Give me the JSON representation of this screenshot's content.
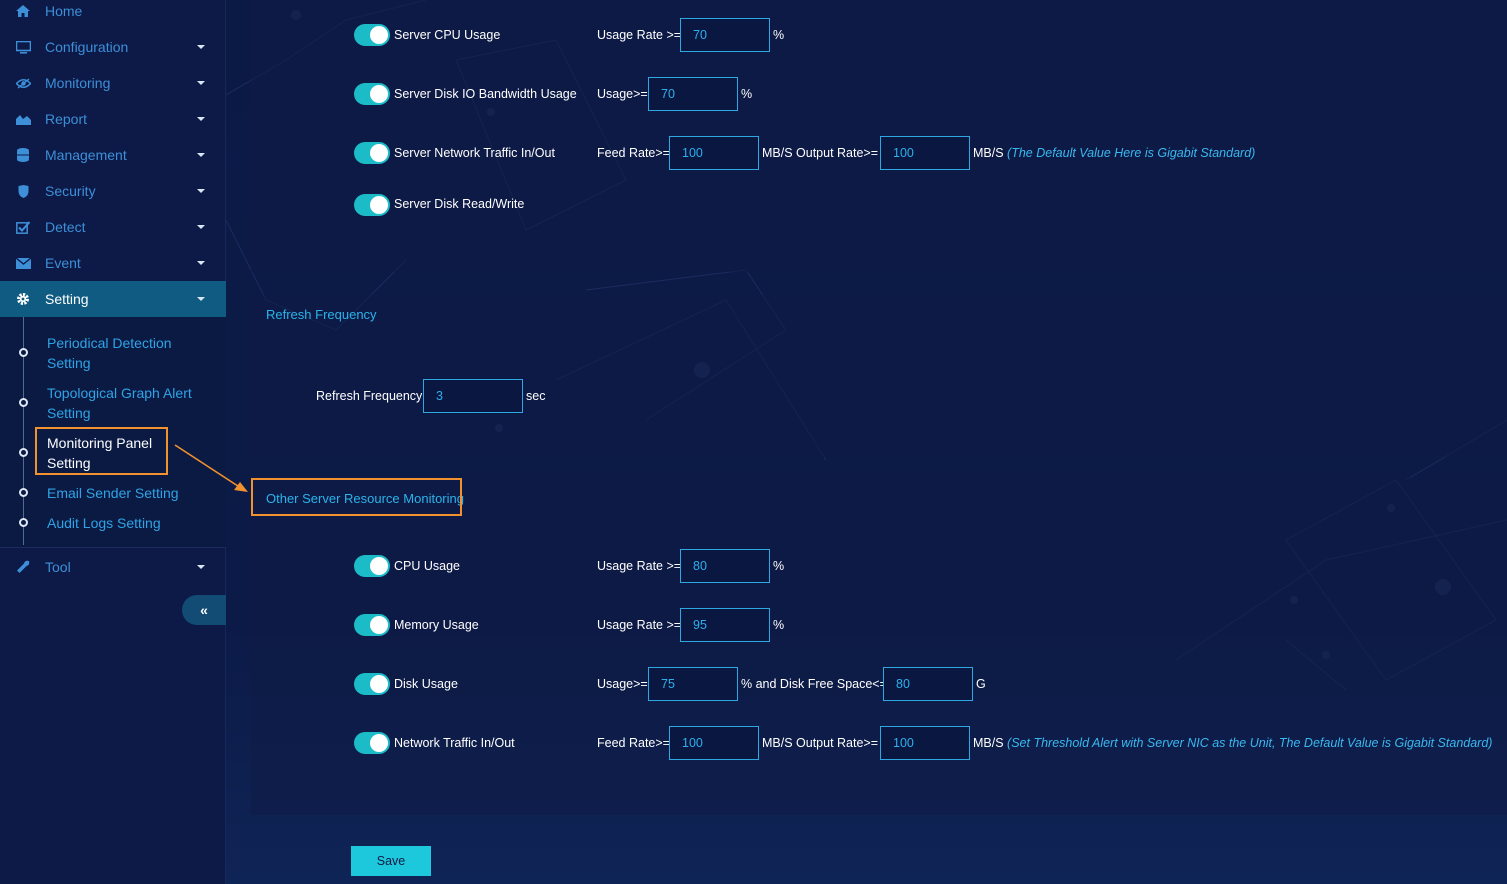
{
  "sidebar": {
    "items": [
      {
        "label": "Home",
        "icon": "home-icon"
      },
      {
        "label": "Configuration",
        "icon": "monitor-icon"
      },
      {
        "label": "Monitoring",
        "icon": "eye-icon"
      },
      {
        "label": "Report",
        "icon": "area-chart-icon"
      },
      {
        "label": "Management",
        "icon": "database-icon"
      },
      {
        "label": "Security",
        "icon": "shield-icon"
      },
      {
        "label": "Detect",
        "icon": "check-square-icon"
      },
      {
        "label": "Event",
        "icon": "envelope-icon"
      },
      {
        "label": "Setting",
        "icon": "gear-icon",
        "active": true
      },
      {
        "label": "Tool",
        "icon": "wrench-icon"
      }
    ],
    "setting_sub": [
      {
        "label": "Periodical Detection Setting"
      },
      {
        "label": "Topological Graph Alert Setting"
      },
      {
        "label": "Monitoring Panel Setting",
        "highlighted": true
      },
      {
        "label": "Email Sender Setting"
      },
      {
        "label": "Audit Logs Setting"
      }
    ],
    "collapse_icon": "«"
  },
  "server": {
    "cpu": {
      "label": "Server CPU Usage",
      "prefix": "Usage Rate >=",
      "value": "70",
      "unit": "%"
    },
    "disk_io": {
      "label": "Server Disk IO Bandwidth Usage",
      "prefix": "Usage>=",
      "value": "70",
      "unit": "%"
    },
    "network": {
      "label": "Server Network Traffic In/Out",
      "feed_prefix": "Feed Rate>=",
      "feed_value": "100",
      "output_prefix": "MB/S Output Rate>=",
      "output_value": "100",
      "unit": "MB/S",
      "note": "(The Default Value Here is Gigabit Standard)"
    },
    "disk_rw": {
      "label": "Server Disk Read/Write"
    }
  },
  "refresh": {
    "title": "Refresh Frequency",
    "label": "Refresh Frequency",
    "value": "3",
    "unit": "sec"
  },
  "other": {
    "title": "Other Server Resource Monitoring",
    "cpu": {
      "label": "CPU Usage",
      "prefix": "Usage Rate >=",
      "value": "80",
      "unit": "%"
    },
    "memory": {
      "label": "Memory Usage",
      "prefix": "Usage Rate >=",
      "value": "95",
      "unit": "%"
    },
    "disk": {
      "label": "Disk Usage",
      "prefix": "Usage>=",
      "value": "75",
      "mid": "% and Disk Free Space<=",
      "free_value": "80",
      "unit": "G"
    },
    "network": {
      "label": "Network Traffic In/Out",
      "feed_prefix": "Feed Rate>=",
      "feed_value": "100",
      "output_prefix": "MB/S Output Rate>=",
      "output_value": "100",
      "unit": "MB/S",
      "note": "(Set Threshold Alert with Server NIC as the Unit, The Default Value is Gigabit Standard)"
    }
  },
  "save_label": "Save",
  "colors": {
    "accent": "#1ec8dc",
    "highlight": "#f2922e",
    "link": "#2fa3e6",
    "active_bg": "#0f5b82"
  }
}
